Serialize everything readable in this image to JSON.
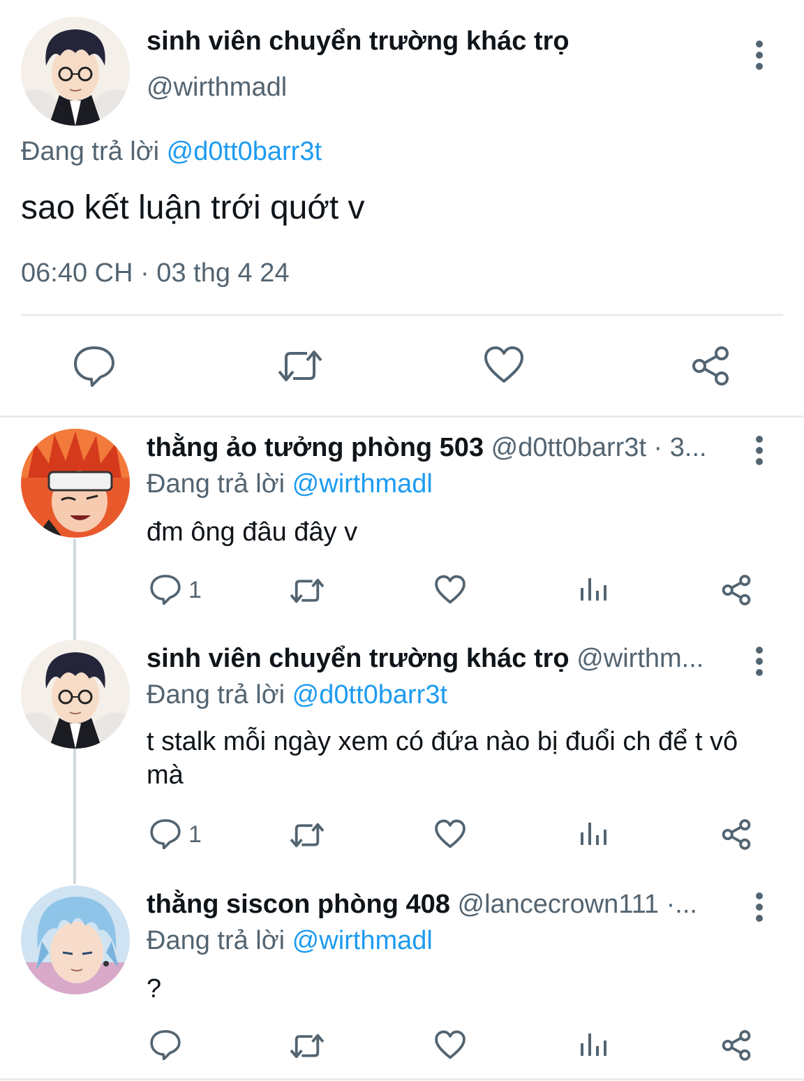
{
  "main_tweet": {
    "display_name": "sinh viên chuyển trường khác trọ",
    "handle": "@wirthmadl",
    "replying_prefix": "Đang trả lời",
    "replying_to": "@d0tt0barr3t",
    "text": "sao kết luận trới quớt v",
    "timestamp": "06:40 CH · 03 thg 4 24",
    "actions": [
      "reply-icon",
      "retweet-icon",
      "like-icon",
      "share-icon"
    ]
  },
  "replies": [
    {
      "display_name": "thằng ảo tưởng phòng 503",
      "meta": "@d0tt0barr3t · 3...",
      "replying_prefix": "Đang trả lời",
      "replying_to": "@wirthmadl",
      "text": "đm ông đâu đây v",
      "reply_count": "1"
    },
    {
      "display_name": "sinh viên chuyển trường khác trọ",
      "meta": "@wirthm...",
      "replying_prefix": "Đang trả lời",
      "replying_to": "@d0tt0barr3t",
      "text": "t stalk mỗi ngày xem có đứa nào bị đuổi ch để t vô mà",
      "reply_count": "1"
    },
    {
      "display_name": "thằng siscon phòng 408",
      "meta": "@lancecrown111 ·...",
      "replying_prefix": "Đang trả lời",
      "replying_to": "@wirthmadl",
      "text": "?",
      "reply_count": ""
    }
  ],
  "colors": {
    "link": "#1d9bf0",
    "secondary_text": "#536471",
    "icon": "#536471",
    "divider": "#e1e6ea"
  }
}
